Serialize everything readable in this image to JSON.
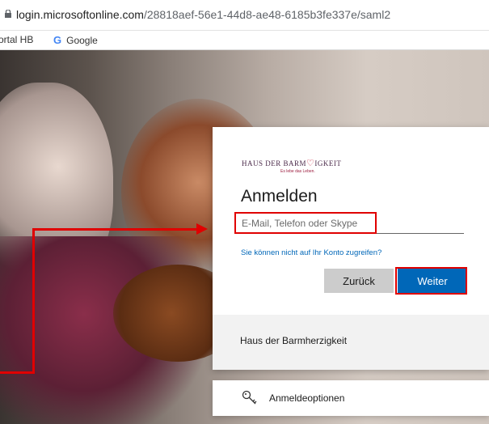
{
  "browser": {
    "url_host": "login.microsoftonline.com",
    "url_path": "/28818aef-56e1-44d8-ae48-6185b3fe337e/saml2",
    "bookmarks": [
      "ortal HB",
      "Google"
    ]
  },
  "login": {
    "logo_name_left": "HAUS DER BARM",
    "logo_name_right": "IGKEIT",
    "logo_tagline": "Es lebe das Leben.",
    "title": "Anmelden",
    "email_placeholder": "E-Mail, Telefon oder Skype",
    "cant_access_link": "Sie können nicht auf Ihr Konto zugreifen?",
    "back_button": "Zurück",
    "next_button": "Weiter",
    "footer_text": "Haus der Barmherzigkeit"
  },
  "signin_options": {
    "label": "Anmeldeoptionen",
    "icon": "key-icon"
  },
  "colors": {
    "accent": "#0067b8",
    "annotation": "#e00000"
  }
}
